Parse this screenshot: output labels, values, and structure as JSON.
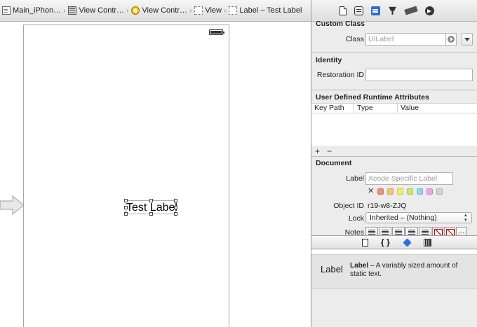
{
  "jumpbar": {
    "crumbs": [
      {
        "label": "Main_iPhon…",
        "icon": "storyboard-file-icon"
      },
      {
        "label": "View Contr…",
        "icon": "scene-icon"
      },
      {
        "label": "View Contr…",
        "icon": "view-controller-icon"
      },
      {
        "label": "View",
        "icon": "view-icon"
      },
      {
        "label": "Label – Test Label",
        "icon": "label-icon"
      }
    ],
    "separator": "›"
  },
  "canvas": {
    "label_text": "Test Label"
  },
  "inspector": {
    "toolbar_icons": [
      "file-inspector-icon",
      "quick-help-icon",
      "identity-inspector-icon",
      "attributes-inspector-icon",
      "size-inspector-icon",
      "connections-inspector-icon"
    ],
    "custom_class": {
      "title": "Custom Class",
      "class_label": "Class",
      "class_placeholder": "UILabel"
    },
    "identity": {
      "title": "Identity",
      "restoration_label": "Restoration ID",
      "restoration_value": ""
    },
    "udra": {
      "title": "User Defined Runtime Attributes",
      "columns": [
        "Key Path",
        "Type",
        "Value"
      ],
      "add": "+",
      "remove": "−"
    },
    "document": {
      "title": "Document",
      "label_label": "Label",
      "label_placeholder": "Xcode Specific Label",
      "swatch_clear": "✕",
      "swatches": [
        "#f28b82",
        "#f7c26b",
        "#f5e96a",
        "#c8e86a",
        "#8fd3f2",
        "#e9a6e6",
        "#d2d2d2"
      ],
      "object_id_label": "Object ID",
      "object_id": "r19-w8-ZJQ",
      "lock_label": "Lock",
      "lock_value": "Inherited – (Nothing)",
      "notes_label": "Notes",
      "notes_more": "…"
    },
    "library": {
      "tab_icons": [
        "file-template-icon",
        "code-snippet-icon",
        "object-library-icon",
        "media-library-icon"
      ],
      "item_thumb": "Label",
      "item_name": "Label",
      "item_desc": " – A variably sized amount of static text."
    }
  }
}
